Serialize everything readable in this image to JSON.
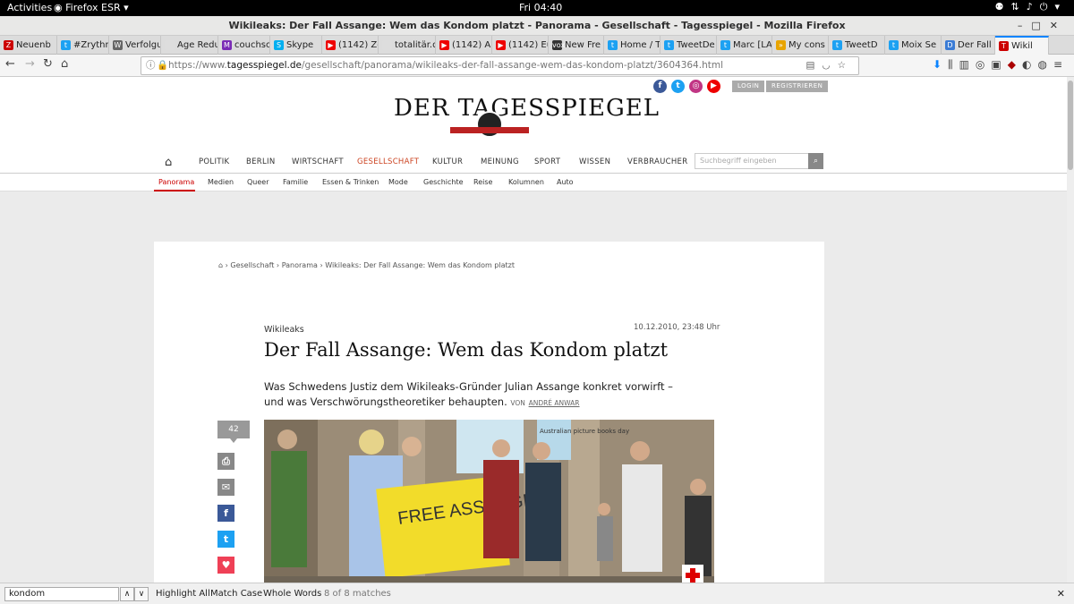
{
  "system": {
    "activities": "Activities",
    "app": "Firefox ESR",
    "clock": "Fri 04:40"
  },
  "window": {
    "title": "Wikileaks: Der Fall Assange: Wem das Kondom platzt - Panorama - Gesellschaft - Tagesspiegel - Mozilla Firefox"
  },
  "tabs": [
    {
      "label": "Neuenb",
      "icon": "Z",
      "color": "#c00"
    },
    {
      "label": "#Zrythm",
      "icon": "t",
      "color": "#1da1f2"
    },
    {
      "label": "Verfolgu",
      "icon": "W",
      "color": "#666"
    },
    {
      "label": "Age Reducti",
      "icon": "",
      "color": "#ddd"
    },
    {
      "label": "couchsof",
      "icon": "M",
      "color": "#7a2bb5"
    },
    {
      "label": "Skype",
      "icon": "S",
      "color": "#00aff0"
    },
    {
      "label": "(1142) Ze",
      "icon": "▶",
      "color": "#e00"
    },
    {
      "label": "totalitär.de",
      "icon": "",
      "color": "#ddd"
    },
    {
      "label": "(1142) Al",
      "icon": "▶",
      "color": "#e00"
    },
    {
      "label": "(1142) Eu",
      "icon": "▶",
      "color": "#e00"
    },
    {
      "label": "New Fre",
      "icon": "vox",
      "color": "#333"
    },
    {
      "label": "Home / T",
      "icon": "t",
      "color": "#1da1f2"
    },
    {
      "label": "TweetDe",
      "icon": "t",
      "color": "#1da1f2"
    },
    {
      "label": "Marc [LA",
      "icon": "t",
      "color": "#1da1f2"
    },
    {
      "label": "My cons",
      "icon": "»",
      "color": "#e8a400"
    },
    {
      "label": "TweetD",
      "icon": "t",
      "color": "#1da1f2"
    },
    {
      "label": "Moix Se",
      "icon": "t",
      "color": "#1da1f2"
    },
    {
      "label": "Der Fall",
      "icon": "D",
      "color": "#3a7bd5"
    },
    {
      "label": "Wikil",
      "icon": "T",
      "color": "#c00"
    }
  ],
  "url": {
    "prefix": "https://www.",
    "domain": "tagesspiegel.de",
    "path": "/gesellschaft/panorama/wikileaks-der-fall-assange-wem-das-kondom-platzt/3604364.html"
  },
  "site": {
    "logo": "DER TAGESSPIEGEL",
    "login": "LOGIN",
    "register": "REGISTRIEREN",
    "search_placeholder": "Suchbegriff eingeben",
    "nav": [
      "POLITIK",
      "BERLIN",
      "WIRTSCHAFT",
      "GESELLSCHAFT",
      "KULTUR",
      "MEINUNG",
      "SPORT",
      "WISSEN",
      "VERBRAUCHER"
    ],
    "subnav": [
      "Panorama",
      "Medien",
      "Queer",
      "Familie",
      "Essen & Trinken",
      "Mode",
      "Geschichte",
      "Reise",
      "Kolumnen",
      "Auto"
    ]
  },
  "breadcrumb": [
    "Gesellschaft",
    "Panorama",
    "Wikileaks: Der Fall Assange: Wem das Kondom platzt"
  ],
  "article": {
    "kicker": "Wikileaks",
    "date": "10.12.2010, 23:48 Uhr",
    "headline": "Der Fall Assange: Wem das Kondom platzt",
    "teaser": "Was Schwedens Justiz dem Wikileaks-Gründer Julian Assange konkret vorwirft – und was Verschwörungstheoretiker behaupten.",
    "byline_prefix": "VON",
    "author": "ANDRÉ ANWAR",
    "comment_count": "42",
    "photo_sign": "FREE ASSANGE",
    "photo_poster": "Australian picture books day"
  },
  "findbar": {
    "query": "kondom",
    "highlight_all": "Highlight All",
    "match_case": "Match Case",
    "whole_words": "Whole Words",
    "matches": "8 of 8 matches"
  }
}
